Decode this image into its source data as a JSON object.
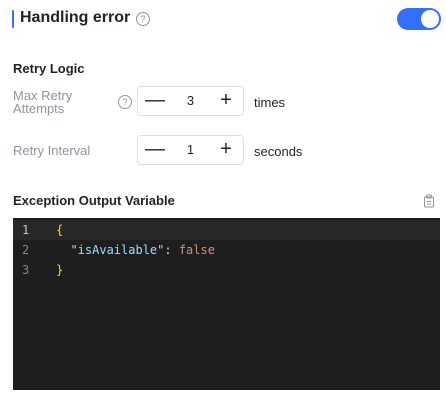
{
  "header": {
    "title": "Handling error",
    "help_icon": "question-circle-icon",
    "toggle_on": true,
    "accent_color": "#3370ff"
  },
  "retry": {
    "section_title": "Retry Logic",
    "max_attempts": {
      "label_line1": "Max Retry",
      "label_line2": "Attempts",
      "value": "3",
      "unit": "times",
      "minus": "—",
      "plus": "+"
    },
    "interval": {
      "label": "Retry Interval",
      "value": "1",
      "unit": "seconds",
      "minus": "—",
      "plus": "+"
    }
  },
  "output": {
    "section_title": "Exception Output Variable",
    "copy_icon": "copy-icon",
    "code": {
      "line_numbers": [
        "1",
        "2",
        "3"
      ],
      "open_brace": "{",
      "key": "\"isAvailable\"",
      "colon": ": ",
      "value": "false",
      "close_brace": "}"
    }
  }
}
